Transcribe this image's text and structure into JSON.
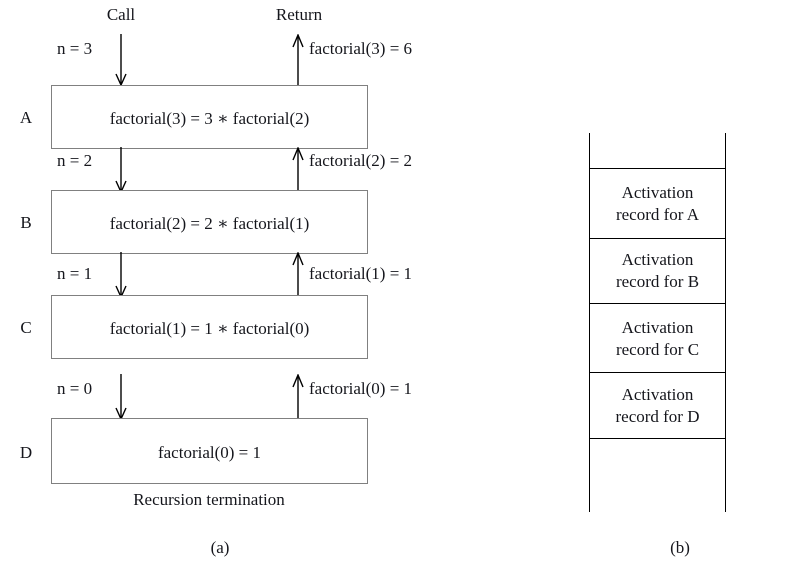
{
  "figure": {
    "headers": {
      "call": "Call",
      "return": "Return"
    },
    "panel_a": {
      "caption": "(a)",
      "termination_note": "Recursion termination",
      "rows": [
        {
          "letter": "A",
          "box_text": "factorial(3) = 3 ∗ factorial(2)",
          "call_label": "n = 3",
          "return_label": "factorial(3) = 6"
        },
        {
          "letter": "B",
          "box_text": "factorial(2) = 2 ∗ factorial(1)",
          "call_label": "n = 2",
          "return_label": "factorial(2) = 2"
        },
        {
          "letter": "C",
          "box_text": "factorial(1) = 1 ∗ factorial(0)",
          "call_label": "n = 1",
          "return_label": "factorial(1) = 1"
        },
        {
          "letter": "D",
          "box_text": "factorial(0) = 1",
          "call_label": "n = 0",
          "return_label": "factorial(0) = 1"
        }
      ]
    },
    "panel_b": {
      "caption": "(b)",
      "cells": [
        {
          "line1": "",
          "line2": ""
        },
        {
          "line1": "Activation",
          "line2": "record for A"
        },
        {
          "line1": "Activation",
          "line2": "record for B"
        },
        {
          "line1": "Activation",
          "line2": "record for C"
        },
        {
          "line1": "Activation",
          "line2": "record for D"
        },
        {
          "line1": "",
          "line2": ""
        }
      ]
    },
    "colors": {
      "box_border": "#808080",
      "stack_border": "#000000",
      "text": "#15161c",
      "background": "#ffffff"
    }
  }
}
